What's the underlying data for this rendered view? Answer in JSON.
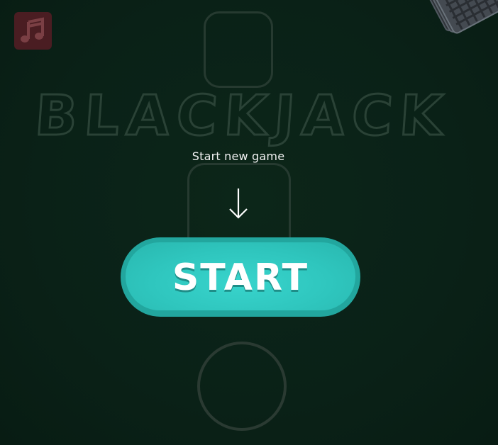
{
  "game": {
    "title": "BLACKJACK",
    "subtitle": "Start new game",
    "start_label": "START"
  },
  "icons": {
    "music": "music-note-icon",
    "arrow": "arrow-down-icon",
    "deck": "card-deck-icon"
  },
  "colors": {
    "felt": "#0a2218",
    "start_button": "#2fc6be",
    "music_button": "#4a1d22",
    "slot_outline": "#263a30"
  }
}
